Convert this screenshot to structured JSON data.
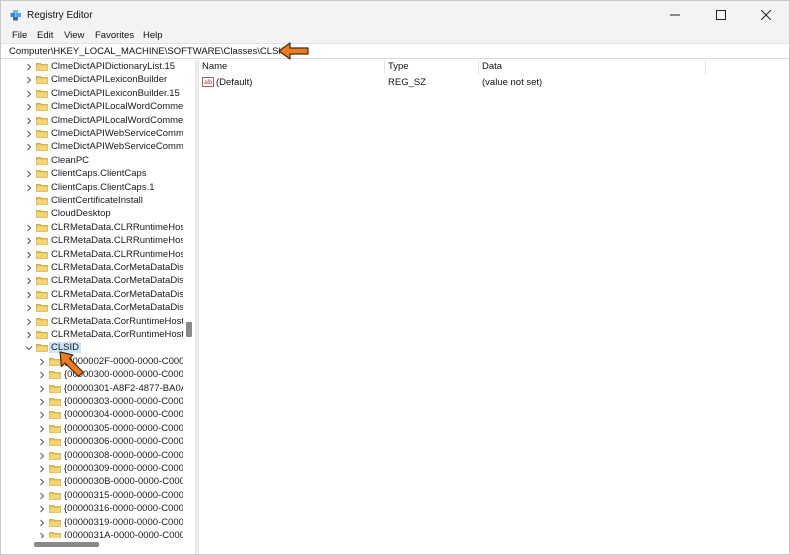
{
  "window": {
    "title": "Registry Editor"
  },
  "menu": [
    "File",
    "Edit",
    "View",
    "Favorites",
    "Help"
  ],
  "address": {
    "path": "Computer\\HKEY_LOCAL_MACHINE\\SOFTWARE\\Classes\\CLSID"
  },
  "tree": {
    "items": [
      "ClmeDictAPIDictionaryList.15",
      "ClmeDictAPILexiconBuilder",
      "ClmeDictAPILexiconBuilder.15",
      "ClmeDictAPILocalWordCommer",
      "ClmeDictAPILocalWordCommer",
      "ClmeDictAPIWebServiceComme",
      "ClmeDictAPIWebServiceComme",
      "CleanPC",
      "ClientCaps.ClientCaps",
      "ClientCaps.ClientCaps.1",
      "ClientCertificateInstall",
      "CloudDesktop",
      "CLRMetaData.CLRRuntimeHost",
      "CLRMetaData.CLRRuntimeHost.",
      "CLRMetaData.CLRRuntimeHost.",
      "CLRMetaData.CorMetaDataDisp",
      "CLRMetaData.CorMetaDataDisp",
      "CLRMetaData.CorMetaDataDisp",
      "CLRMetaData.CorMetaDataDisp",
      "CLRMetaData.CorRuntimeHost",
      "CLRMetaData.CorRuntimeHost.2"
    ],
    "selected": "CLSID",
    "children": [
      "{0000002F-0000-0000-C000-",
      "{00000300-0000-0000-C000-",
      "{00000301-A8F2-4877-BA0A",
      "{00000303-0000-0000-C000-",
      "{00000304-0000-0000-C000-",
      "{00000305-0000-0000-C000-",
      "{00000306-0000-0000-C000-",
      "{00000308-0000-0000-C000-",
      "{00000309-0000-0000-C000-",
      "{0000030B-0000-0000-C000-",
      "{00000315-0000-0000-C000-",
      "{00000316-0000-0000-C000-",
      "{00000319-0000-0000-C000-",
      "{0000031A-0000-0000-C000-"
    ]
  },
  "list": {
    "columns": [
      "Name",
      "Type",
      "Data"
    ],
    "rows": [
      {
        "name": "(Default)",
        "type": "REG_SZ",
        "data": "(value not set)",
        "icon": "ab-string-icon"
      }
    ]
  },
  "icons": {
    "folder": "folder-icon",
    "expand": "chevron-right-icon",
    "collapse": "chevron-down-icon"
  },
  "colors": {
    "folder": "#e8c252",
    "selection": "#cce4f7",
    "arrow": "#f07a1d"
  }
}
